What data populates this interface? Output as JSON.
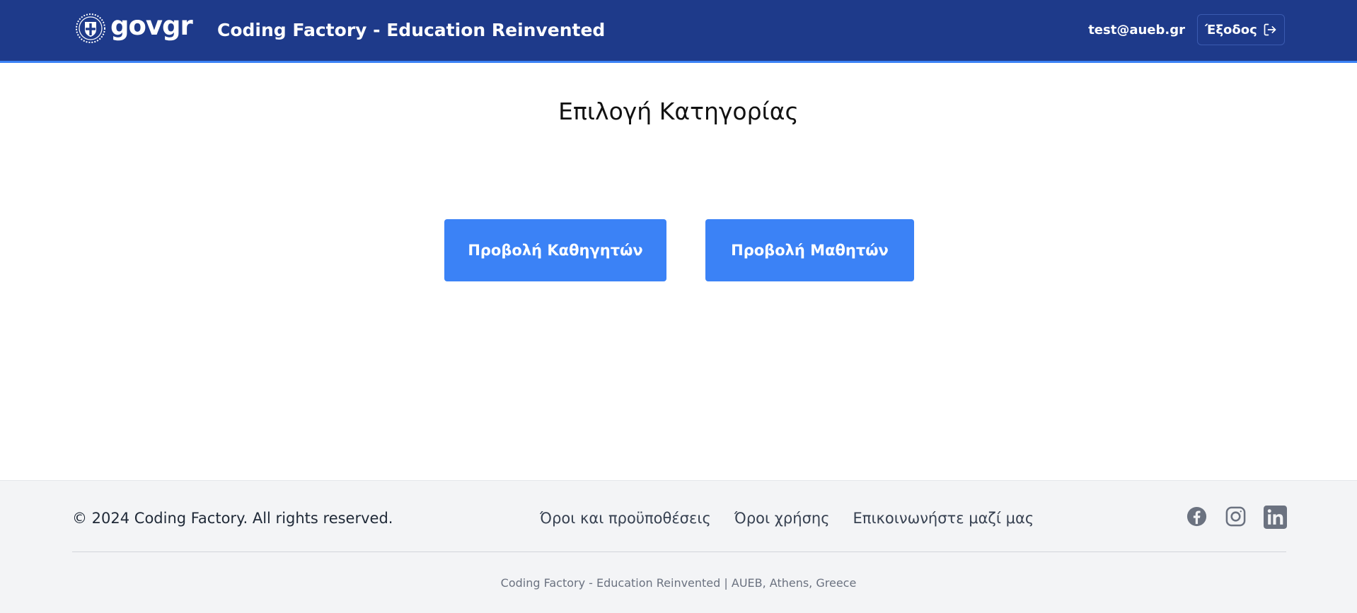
{
  "header": {
    "logo_text": "govgr",
    "site_title": "Coding Factory - Education Reinvented",
    "user_email": "test@aueb.gr",
    "logout_label": "Έξοδος",
    "background_color": "#1e3a8a",
    "accent_color": "#3b82f6"
  },
  "main": {
    "title": "Επιλογή Κατηγορίας",
    "buttons": [
      {
        "label": "Προβολή Καθηγητών"
      },
      {
        "label": "Προβολή Μαθητών"
      }
    ],
    "button_color": "#3b82f6"
  },
  "footer": {
    "copyright": "© 2024 Coding Factory. All rights reserved.",
    "links": [
      {
        "label": "Όροι και προϋποθέσεις"
      },
      {
        "label": "Όροι χρήσης"
      },
      {
        "label": "Επικοινωνήστε μαζί μας"
      }
    ],
    "social_icons": [
      "facebook-icon",
      "instagram-icon",
      "linkedin-icon"
    ],
    "bottom_text": "Coding Factory - Education Reinvented | AUEB, Athens, Greece",
    "background_color": "#f3f4f6"
  }
}
